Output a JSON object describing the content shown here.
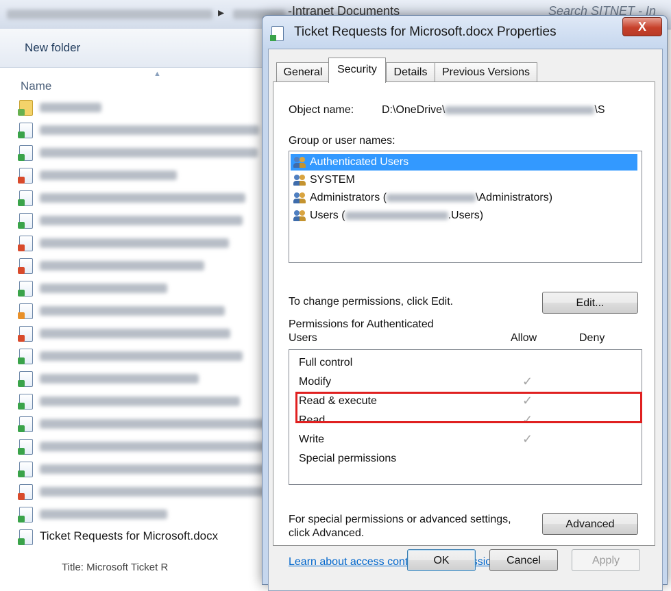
{
  "explorer": {
    "address_segment": "-Intranet Documents",
    "search_placeholder": "Search SITNET - In",
    "new_folder_label": "New folder",
    "column_name": "Name",
    "files": [
      {
        "name": "",
        "icon": "folder-icon"
      },
      {
        "name": "",
        "icon": "word-doc-icon"
      },
      {
        "name": "",
        "icon": "word-doc-icon"
      },
      {
        "name": "",
        "icon": "powerpoint-doc-icon"
      },
      {
        "name": "",
        "icon": "excel-doc-icon"
      },
      {
        "name": "",
        "icon": "excel-doc-icon"
      },
      {
        "name": "",
        "icon": "powerpoint-doc-icon"
      },
      {
        "name": "",
        "icon": "powerpoint-doc-icon"
      },
      {
        "name": "",
        "icon": "excel-doc-icon"
      },
      {
        "name": "",
        "icon": "pdf-doc-icon"
      },
      {
        "name": "",
        "icon": "powerpoint-doc-icon"
      },
      {
        "name": "",
        "icon": "word-doc-icon"
      },
      {
        "name": "",
        "icon": "excel-doc-icon"
      },
      {
        "name": "",
        "icon": "excel-doc-icon"
      },
      {
        "name": "",
        "icon": "excel-doc-icon"
      },
      {
        "name": "",
        "icon": "excel-doc-icon"
      },
      {
        "name": "",
        "icon": "word-doc-icon"
      },
      {
        "name": "",
        "icon": "powerpoint-doc-icon"
      },
      {
        "name": "",
        "icon": "excel-doc-icon"
      }
    ],
    "highlighted_file": "Ticket Requests for Microsoft.docx",
    "bottom_text": "Title: Microsoft Ticket R"
  },
  "dialog": {
    "title": "Ticket Requests for Microsoft.docx Properties",
    "close_label": "X",
    "tabs": [
      "General",
      "Security",
      "Details",
      "Previous Versions"
    ],
    "active_tab": "Security",
    "object_name_label": "Object name:",
    "object_name_value": "D:\\OneDrive\\",
    "object_name_tail": "\\S",
    "group_label": "Group or user names:",
    "users": [
      {
        "name": "Authenticated Users",
        "selected": true
      },
      {
        "name": "SYSTEM",
        "selected": false
      },
      {
        "prefix": "Administrators (",
        "suffix": "\\Administrators)"
      },
      {
        "prefix": "Users (",
        "suffix": ".Users)"
      }
    ],
    "change_perm_text": "To change permissions, click Edit.",
    "edit_button": "Edit...",
    "permissions_for_line1": "Permissions for Authenticated",
    "permissions_for_line2": "Users",
    "allow_header": "Allow",
    "deny_header": "Deny",
    "permissions": [
      {
        "name": "Full control",
        "allow": false
      },
      {
        "name": "Modify",
        "allow": true
      },
      {
        "name": "Read & execute",
        "allow": true
      },
      {
        "name": "Read",
        "allow": true
      },
      {
        "name": "Write",
        "allow": true
      },
      {
        "name": "Special permissions",
        "allow": false
      }
    ],
    "check_glyph": "✓",
    "special_text_line1": "For special permissions or advanced settings,",
    "special_text_line2": "click Advanced.",
    "advanced_button": "Advanced",
    "learn_link": "Learn about access control and permissions",
    "ok_button": "OK",
    "cancel_button": "Cancel",
    "apply_button": "Apply",
    "highlight_color": "#e02020",
    "selection_color": "#3399ff"
  }
}
